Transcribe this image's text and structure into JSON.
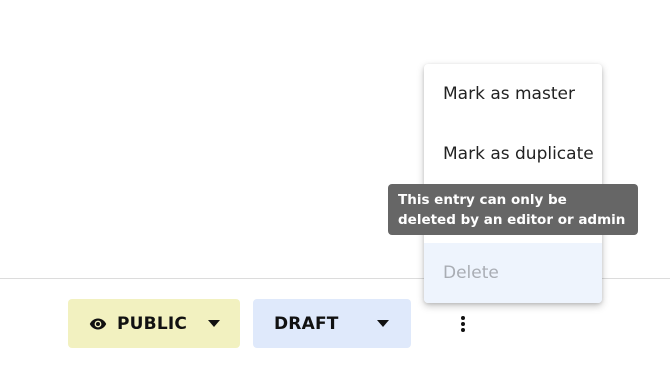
{
  "toolbar": {
    "visibility": {
      "label": "PUBLIC",
      "icon": "eye-icon",
      "background": "#f2f1c0"
    },
    "state": {
      "label": "DRAFT",
      "background": "#dfe9fb"
    },
    "more_icon": "vertical-dots-icon"
  },
  "menu": {
    "items": [
      {
        "label": "Mark as master",
        "enabled": true
      },
      {
        "label": "Mark as duplicate",
        "enabled": true
      },
      {
        "label": "Delete",
        "enabled": false
      }
    ]
  },
  "tooltip": {
    "text": "This entry can only be deleted by an editor or admin",
    "background": "#666666"
  }
}
